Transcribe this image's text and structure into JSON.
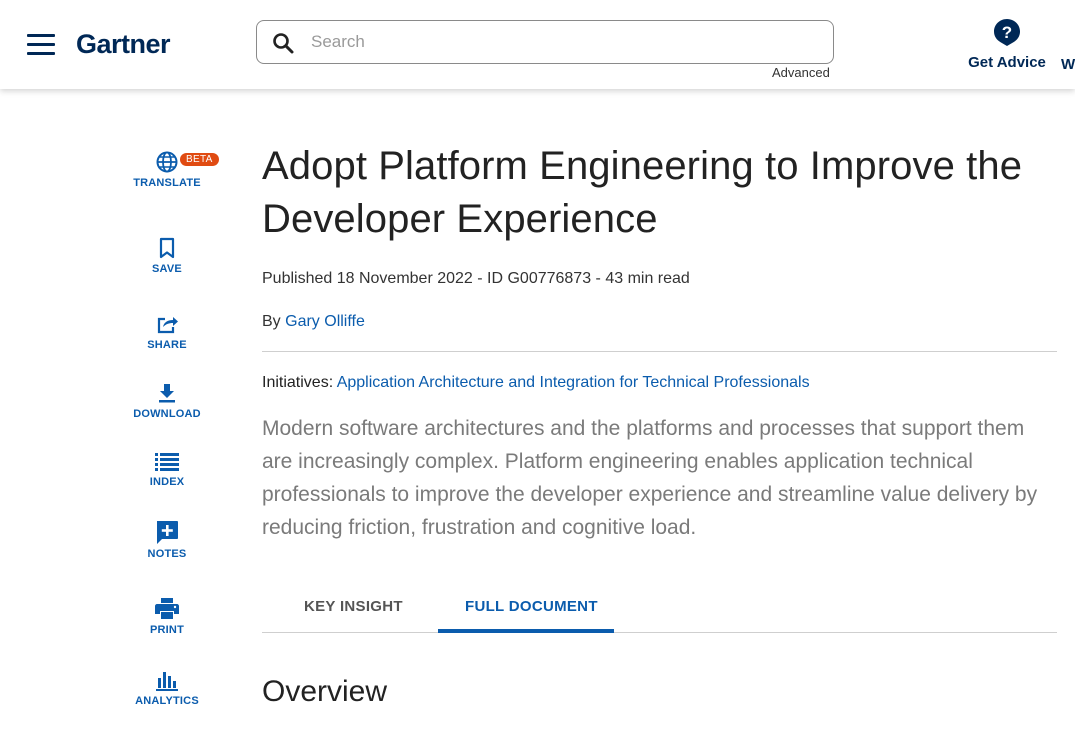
{
  "header": {
    "logo": "Gartner",
    "search": {
      "placeholder": "Search",
      "value": ""
    },
    "advanced_label": "Advanced",
    "get_advice_label": "Get Advice",
    "cut_off_label": "W"
  },
  "toolbar": {
    "beta_badge": "BETA",
    "items": [
      {
        "label": "TRANSLATE",
        "icon": "globe-icon"
      },
      {
        "label": "SAVE",
        "icon": "bookmark-icon"
      },
      {
        "label": "SHARE",
        "icon": "share-icon"
      },
      {
        "label": "DOWNLOAD",
        "icon": "download-icon"
      },
      {
        "label": "INDEX",
        "icon": "list-icon"
      },
      {
        "label": "NOTES",
        "icon": "note-add-icon"
      },
      {
        "label": "PRINT",
        "icon": "printer-icon"
      },
      {
        "label": "ANALYTICS",
        "icon": "bar-chart-icon"
      }
    ]
  },
  "article": {
    "title": "Adopt Platform Engineering to Improve the Developer Experience",
    "meta": "Published 18 November 2022 - ID G00776873 - 43 min read",
    "by_prefix": "By ",
    "author": "Gary Olliffe",
    "initiatives_label": "Initiatives: ",
    "initiative_link": "Application Architecture and Integration for Technical Professionals",
    "summary": "Modern software architectures and the platforms and processes that support them are increasingly complex. Platform engineering enables application technical professionals to improve the developer experience and streamline value delivery by reducing friction, frustration and cognitive load.",
    "tabs": [
      {
        "label": "KEY INSIGHT",
        "active": false
      },
      {
        "label": "FULL DOCUMENT",
        "active": true
      }
    ],
    "section_heading": "Overview"
  },
  "colors": {
    "brand": "#002856",
    "link": "#0b5cad",
    "beta": "#e04b12"
  }
}
